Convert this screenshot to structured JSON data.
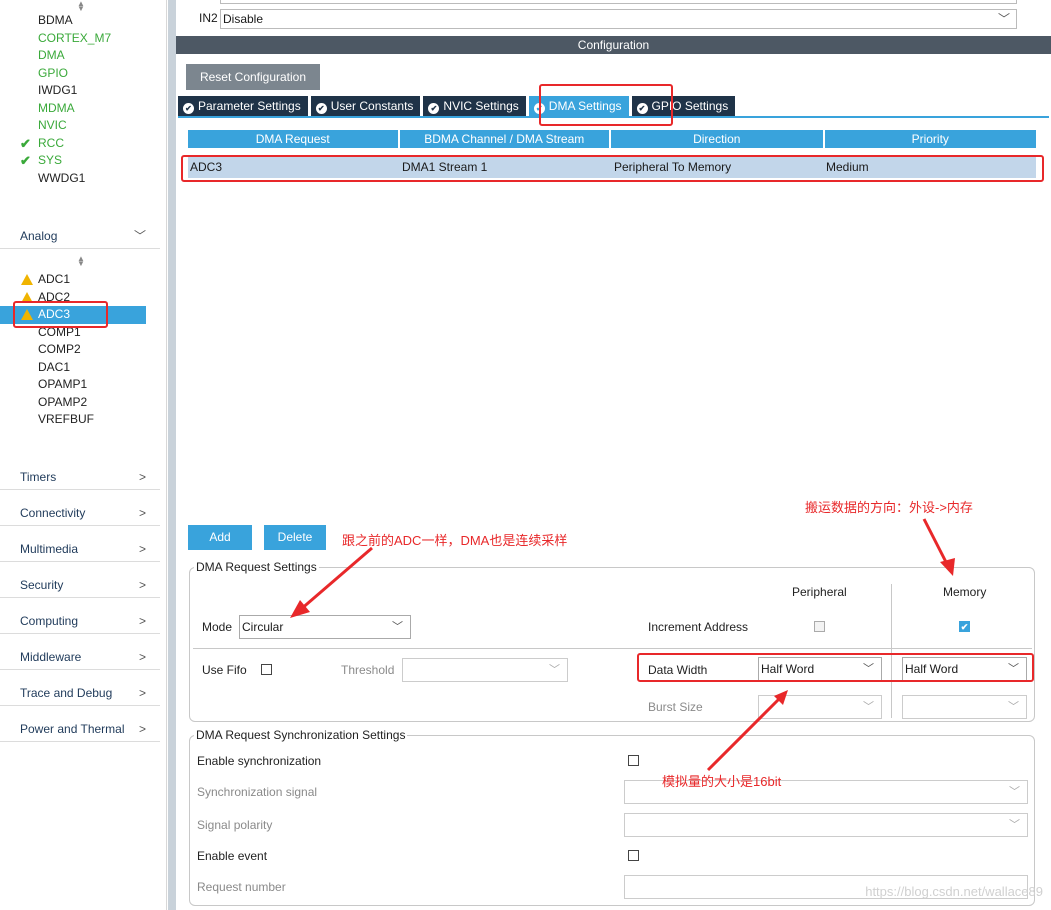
{
  "sidebar": {
    "top_items": [
      {
        "label": "BDMA",
        "style": "dark"
      },
      {
        "label": "CORTEX_M7",
        "style": "green"
      },
      {
        "label": "DMA",
        "style": "green"
      },
      {
        "label": "GPIO",
        "style": "green"
      },
      {
        "label": "IWDG1",
        "style": "dark"
      },
      {
        "label": "MDMA",
        "style": "green"
      },
      {
        "label": "NVIC",
        "style": "green"
      },
      {
        "label": "RCC",
        "style": "green-check"
      },
      {
        "label": "SYS",
        "style": "green-check"
      },
      {
        "label": "WWDG1",
        "style": "dark"
      }
    ],
    "analog_category": "Analog",
    "analog_items": [
      {
        "label": "ADC1",
        "style": "warn"
      },
      {
        "label": "ADC2",
        "style": "warn"
      },
      {
        "label": "ADC3",
        "style": "warn-selected"
      },
      {
        "label": "COMP1",
        "style": "dark"
      },
      {
        "label": "COMP2",
        "style": "dark"
      },
      {
        "label": "DAC1",
        "style": "dark"
      },
      {
        "label": "OPAMP1",
        "style": "dark"
      },
      {
        "label": "OPAMP2",
        "style": "dark"
      },
      {
        "label": "VREFBUF",
        "style": "dark"
      }
    ],
    "categories": [
      "Timers",
      "Connectivity",
      "Multimedia",
      "Security",
      "Computing",
      "Middleware",
      "Trace and Debug",
      "Power and Thermal"
    ]
  },
  "top": {
    "in2_label": "IN2",
    "in2_value": "Disable"
  },
  "config": {
    "header": "Configuration",
    "reset_button": "Reset Configuration",
    "tabs": [
      "Parameter Settings",
      "User Constants",
      "NVIC Settings",
      "DMA Settings",
      "GPIO Settings"
    ],
    "active_tab": "DMA Settings"
  },
  "dma_table": {
    "columns": [
      "DMA Request",
      "BDMA Channel / DMA Stream",
      "Direction",
      "Priority"
    ],
    "rows": [
      [
        "ADC3",
        "DMA1 Stream 1",
        "Peripheral To Memory",
        "Medium"
      ]
    ]
  },
  "buttons": {
    "add": "Add",
    "delete": "Delete"
  },
  "request_settings": {
    "legend": "DMA Request Settings",
    "peripheral_header": "Peripheral",
    "memory_header": "Memory",
    "mode_label": "Mode",
    "mode_value": "Circular",
    "increment_address_label": "Increment Address",
    "peripheral_increment": false,
    "memory_increment": true,
    "use_fifo_label": "Use Fifo",
    "threshold_label": "Threshold",
    "threshold_value": "",
    "data_width_label": "Data Width",
    "peripheral_data_width": "Half Word",
    "memory_data_width": "Half Word",
    "burst_size_label": "Burst Size",
    "peripheral_burst": "",
    "memory_burst": ""
  },
  "sync_settings": {
    "legend": "DMA Request Synchronization Settings",
    "enable_sync_label": "Enable synchronization",
    "sync_signal_label": "Synchronization signal",
    "signal_polarity_label": "Signal polarity",
    "enable_event_label": "Enable event",
    "request_number_label": "Request number"
  },
  "annotations": {
    "same_as_adc": "跟之前的ADC一样，DMA也是连续采样",
    "direction": "搬运数据的方向：外设->内存",
    "size": "模拟量的大小是16bit"
  },
  "watermark": "https://blog.csdn.net/wallace89",
  "colors": {
    "accent": "#39a3dc",
    "tab_dark": "#1f3348",
    "header": "#4d5864",
    "annotation": "#e8282a",
    "green": "#3aa93a",
    "warning": "#f0b400"
  }
}
